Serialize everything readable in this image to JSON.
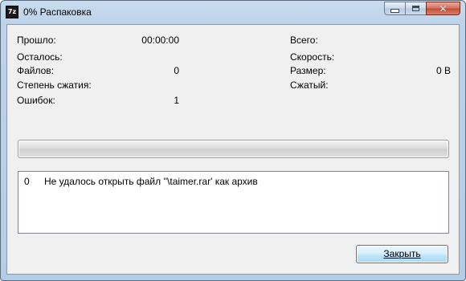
{
  "window": {
    "title": "0% Распаковка",
    "app_icon_text": "7z",
    "caption": {
      "minimize": "–",
      "maximize": "□",
      "close": "✕"
    }
  },
  "stats": {
    "left": [
      {
        "label": "Прошло:",
        "value": "00:00:00"
      },
      {
        "label": "Осталось:",
        "value": ""
      },
      {
        "label": "Файлов:",
        "value": "0"
      },
      {
        "label": "Степень сжатия:",
        "value": ""
      },
      {
        "label": "Ошибок:",
        "value": "1"
      }
    ],
    "right": [
      {
        "label": "Всего:",
        "value": ""
      },
      {
        "label": "Скорость:",
        "value": ""
      },
      {
        "label": "Размер:",
        "value": "0 B"
      },
      {
        "label": "Сжатый:",
        "value": ""
      }
    ]
  },
  "progress": {
    "percent": 0
  },
  "log": {
    "rows": [
      {
        "num": "0",
        "message": "Не удалось открыть файл ''\\taimer.rar' как архив"
      }
    ]
  },
  "buttons": {
    "close_label": "Закрыть"
  },
  "colors": {
    "progress_fill": "#2fb62f",
    "title_bar": "#bcd3ea",
    "close_caption": "#c24a35"
  }
}
